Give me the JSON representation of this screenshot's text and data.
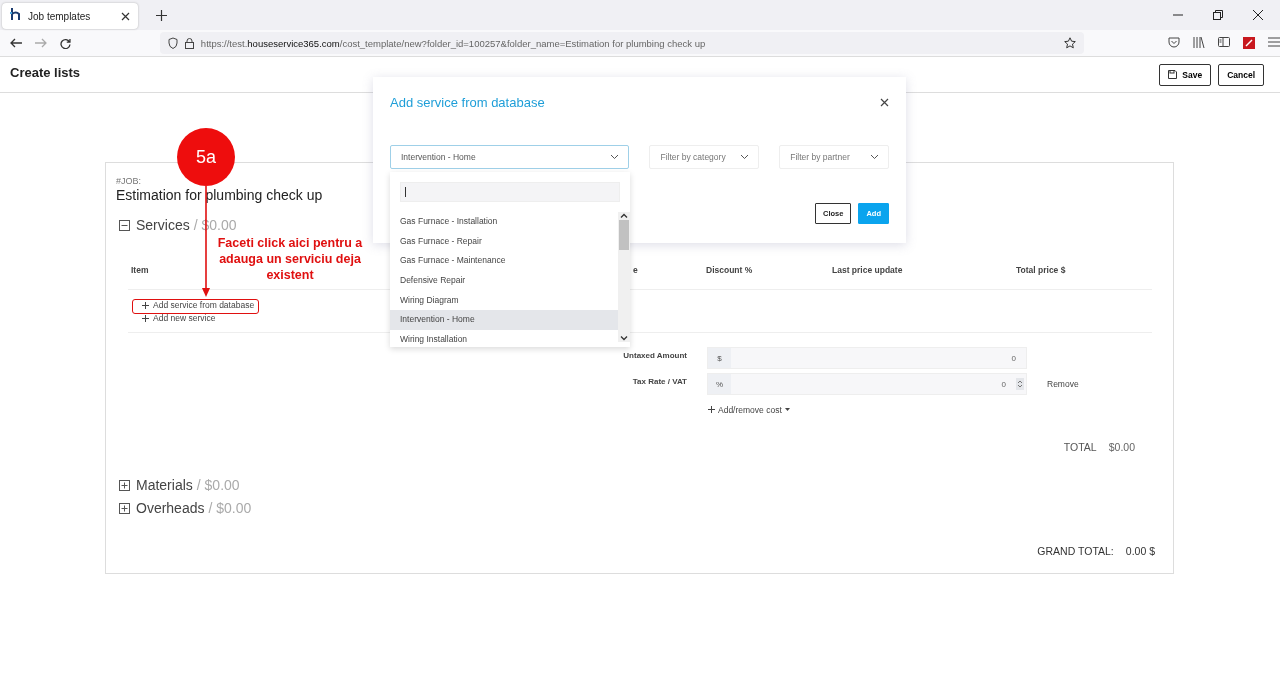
{
  "browser": {
    "tab": {
      "title": "Job templates"
    },
    "url": {
      "scheme": "https://test.",
      "host": "houseservice365.com",
      "path": "/cost_template/new?folder_id=100257&folder_name=Estimation for plumbing check up"
    }
  },
  "page": {
    "title": "Create lists",
    "buttons": [
      {
        "label": "Save",
        "kind": "save"
      },
      {
        "label": "Cancel",
        "kind": "plain"
      }
    ]
  },
  "job": {
    "label": "#JOB:",
    "title": "Estimation for plumbing check up"
  },
  "sections": [
    {
      "name": "Services",
      "amount": "/ $0.00",
      "expanded": true
    },
    {
      "name": "Materials",
      "amount": "/ $0.00",
      "expanded": false
    },
    {
      "name": "Overheads",
      "amount": "/ $0.00",
      "expanded": false
    }
  ],
  "table": {
    "columns": [
      "Item",
      "e",
      "Discount %",
      "Last price update",
      "Total price $"
    ]
  },
  "add_links": [
    "Add service from database",
    "Add new service"
  ],
  "costs": [
    {
      "label": "Untaxed Amount",
      "unit": "$",
      "value": "0",
      "kind": "amount"
    },
    {
      "label": "Tax Rate / VAT",
      "unit": "%",
      "value": "0",
      "kind": "rate",
      "action": "Remove"
    }
  ],
  "add_remove_cost": "Add/remove cost",
  "total": {
    "label": "TOTAL",
    "value": "$0.00"
  },
  "grand_total": {
    "label": "GRAND TOTAL:",
    "value": "0.00 $"
  },
  "modal": {
    "title": "Add service from database",
    "select": {
      "value": "Intervention - Home",
      "expanded": true
    },
    "filters": [
      {
        "placeholder": "Filter by category"
      },
      {
        "placeholder": "Filter by partner"
      }
    ],
    "options": [
      {
        "label": "Gas Furnace - Installation",
        "selected": false
      },
      {
        "label": "Gas Furnace - Repair",
        "selected": false
      },
      {
        "label": "Gas Furnace - Maintenance",
        "selected": false
      },
      {
        "label": "Defensive Repair",
        "selected": false
      },
      {
        "label": "Wiring Diagram",
        "selected": false
      },
      {
        "label": "Intervention - Home",
        "selected": true
      },
      {
        "label": "Wiring Installation",
        "selected": false
      }
    ],
    "buttons": [
      {
        "label": "Close",
        "kind": "secondary"
      },
      {
        "label": "Add",
        "kind": "primary"
      }
    ]
  },
  "annotation": {
    "step": "5a",
    "note": "Faceti click aici pentru a adauga un serviciu deja existent"
  }
}
